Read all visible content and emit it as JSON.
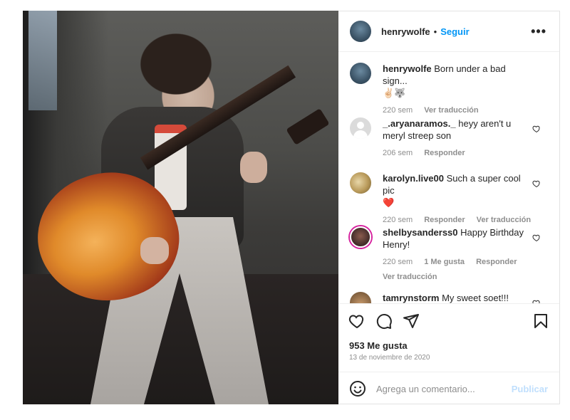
{
  "post": {
    "author": "henrywolfe",
    "follow_label": "Seguir",
    "separator": "•",
    "more_label": "•••"
  },
  "comments": [
    {
      "username": "henrywolfe",
      "text": "Born under a bad sign...",
      "emojis": "✌🏻🐺",
      "time": "220 sem",
      "actions": [
        "Ver traducción"
      ],
      "avatar": "henry"
    },
    {
      "username": "_.aryanaramos._",
      "text": "heyy aren't u meryl streep son",
      "time": "206 sem",
      "actions": [
        "Responder"
      ],
      "avatar": "default"
    },
    {
      "username": "karolyn.live00",
      "text": "Such a super cool pic",
      "emojis": "❤️",
      "time": "220 sem",
      "actions": [
        "Responder",
        "Ver traducción"
      ],
      "avatar": "karolyn"
    },
    {
      "username": "shelbysanderss0",
      "text": "Happy Birthday Henry!",
      "time": "220 sem",
      "actions": [
        "1 Me gusta",
        "Responder"
      ],
      "extra_action": "Ver traducción",
      "avatar": "shelby"
    },
    {
      "username": "tamrynstorm",
      "text": "My sweet soet!!!",
      "avatar": "tamryn"
    }
  ],
  "engagement": {
    "likes": "953 Me gusta",
    "date": "13 de noviembre de 2020"
  },
  "composer": {
    "placeholder": "Agrega un comentario...",
    "publish_label": "Publicar"
  },
  "icons": {
    "like": "heart-icon",
    "comment": "comment-icon",
    "share": "send-icon",
    "save": "bookmark-icon",
    "emoji": "smiley-icon",
    "more": "more-icon"
  },
  "colors": {
    "link_blue": "#0095f6",
    "muted": "#8e8e8e",
    "publish_disabled": "#c0dffd",
    "heart_red": "#ed4956"
  }
}
